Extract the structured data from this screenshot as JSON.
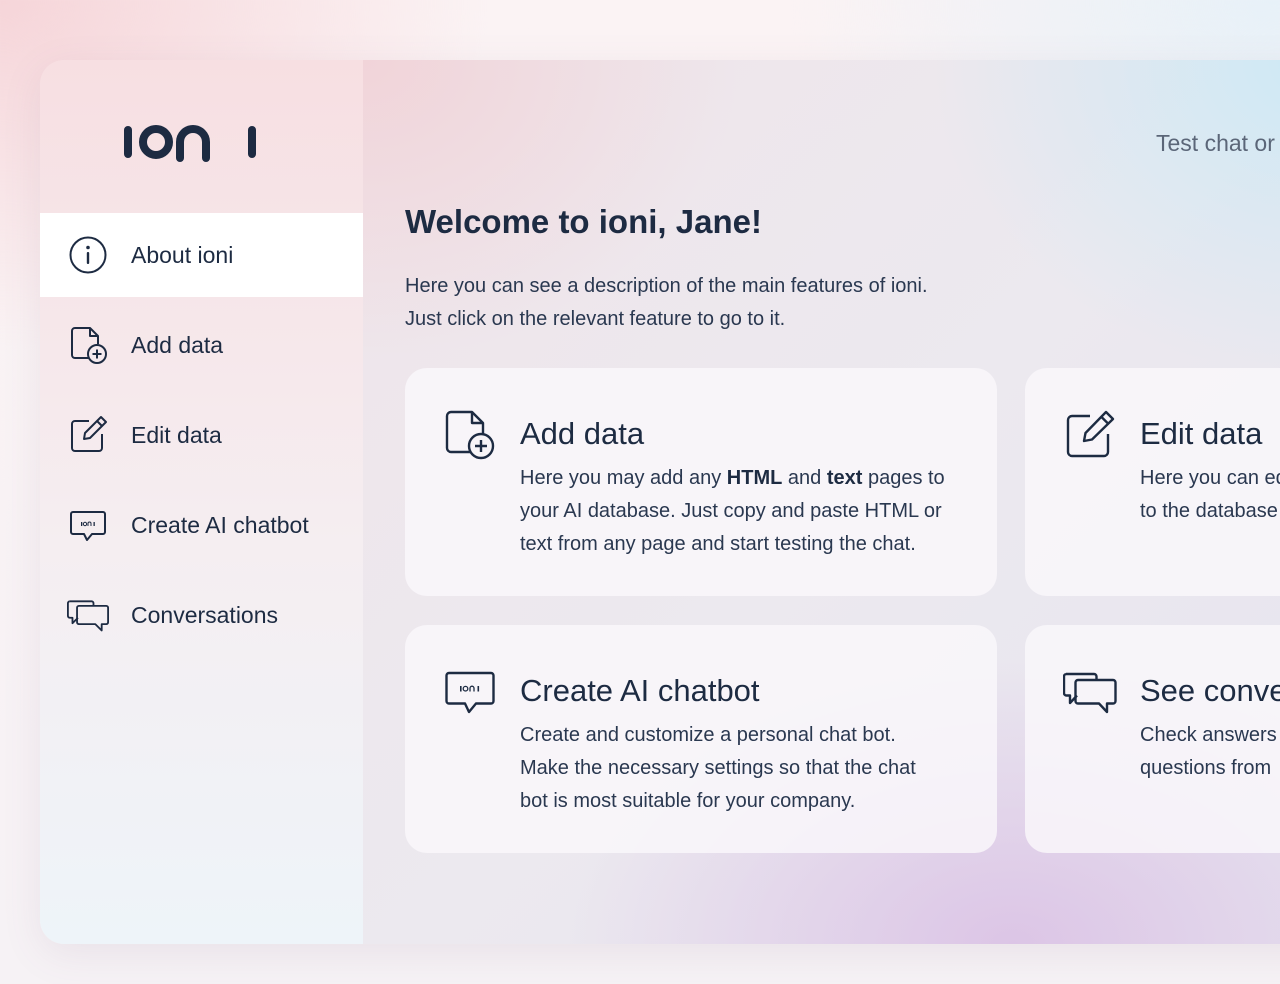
{
  "app": {
    "logo_text": "ioni"
  },
  "sidebar": {
    "items": [
      {
        "label": "About ioni",
        "icon": "info-icon",
        "active": true
      },
      {
        "label": "Add data",
        "icon": "add-document-icon",
        "active": false
      },
      {
        "label": "Edit data",
        "icon": "edit-icon",
        "active": false
      },
      {
        "label": "Create AI chatbot",
        "icon": "chatbot-icon",
        "active": false
      },
      {
        "label": "Conversations",
        "icon": "conversations-icon",
        "active": false
      }
    ]
  },
  "header": {
    "test_chat_label": "Test chat or"
  },
  "main": {
    "welcome_title": "Welcome to ioni, Jane!",
    "intro_line_1": "Here you can see a description of the main features of ioni.",
    "intro_line_2": "Just click on the relevant feature to go to it.",
    "cards": {
      "add_data": {
        "title": "Add data",
        "icon": "add-document-icon",
        "line1_a": "Here you may add any ",
        "line1_b": "HTML",
        "line1_c": " and ",
        "line1_d": "text",
        "line1_e": " pages to",
        "line2": "your AI database. Just copy and paste HTML or",
        "line3": "text from any page and start testing the chat."
      },
      "edit_data": {
        "title": "Edit data",
        "icon": "edit-icon",
        "line1": "Here you can ed",
        "line2": "to the database"
      },
      "create_chatbot": {
        "title": "Create AI chatbot",
        "icon": "chatbot-icon",
        "line1": "Create and customize a personal chat bot.",
        "line2": "Make the necessary settings so that the chat",
        "line3": "bot is most suitable for your company."
      },
      "see_conversations": {
        "title": "See conve",
        "icon": "conversations-icon",
        "line1": "Check answers",
        "line2": "questions from"
      }
    }
  },
  "colors": {
    "text_primary": "#1d2b42",
    "text_secondary": "#5b6678",
    "active_item_bg": "#ffffff",
    "card_bg": "#faf8fb"
  }
}
